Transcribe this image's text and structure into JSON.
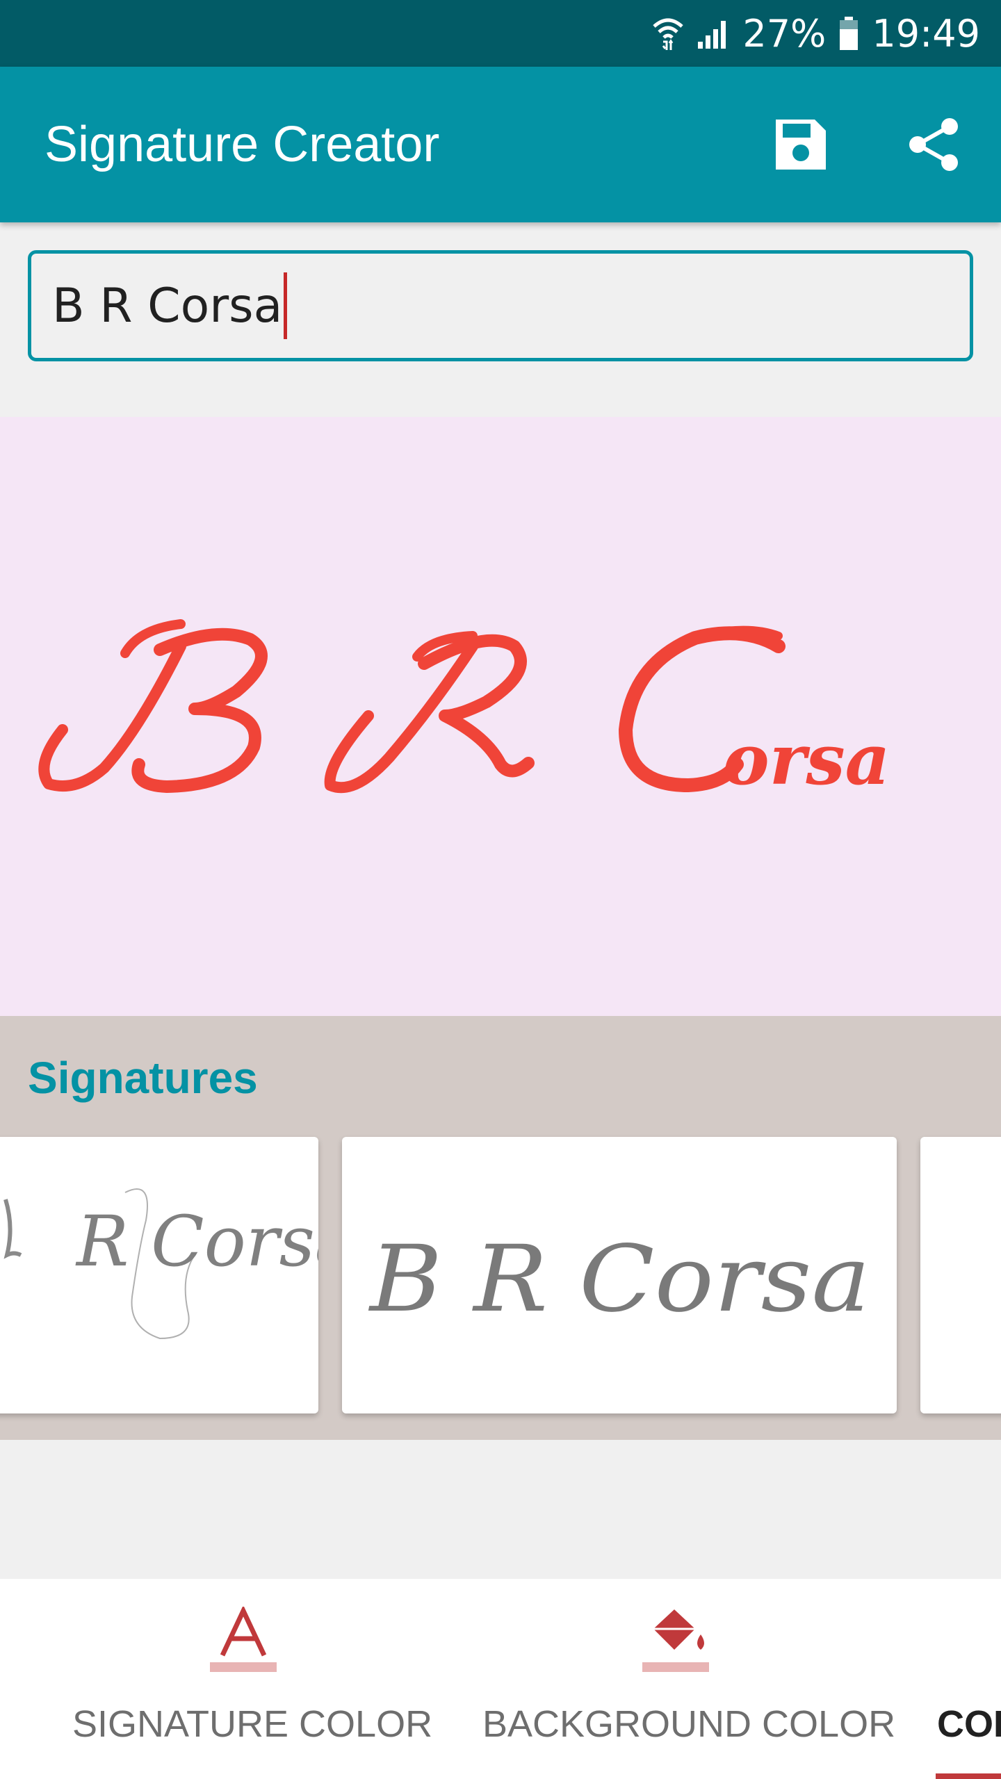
{
  "status_bar": {
    "battery": "27%",
    "time": "19:49",
    "icons": [
      "wifi-icon",
      "signal-icon",
      "battery-icon"
    ]
  },
  "app_bar": {
    "title": "Signature Creator",
    "actions": [
      "save-icon",
      "share-icon"
    ]
  },
  "name_input": {
    "value": "B R Corsa"
  },
  "preview": {
    "signature_text": "B R Corsa",
    "text_color": "#f04438",
    "background_color": "#f5e6f6"
  },
  "signatures_section": {
    "title": "Signatures",
    "cards": [
      {
        "text": "R Corsa"
      },
      {
        "text": "B R Corsa"
      }
    ]
  },
  "bottom_tabs": {
    "signature_color": {
      "label": "SIGNATURE COLOR",
      "icon": "text-color-icon"
    },
    "background_color": {
      "label": "BACKGROUND COLOR",
      "icon": "paint-bucket-icon"
    },
    "third": {
      "label": "COL"
    }
  },
  "colors": {
    "status_bar": "#025b66",
    "app_bar": "#0492a4",
    "accent": "#c0393b",
    "signature_gray": "#7a7a7a"
  }
}
